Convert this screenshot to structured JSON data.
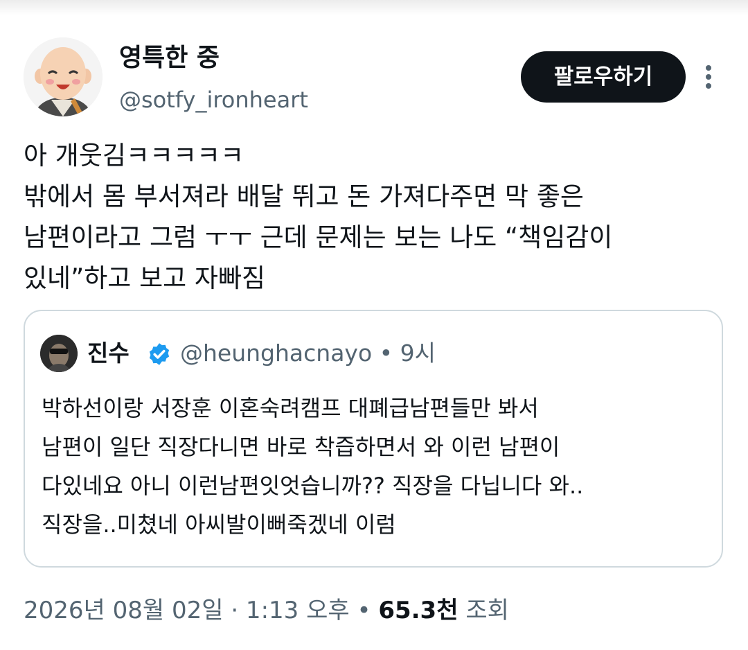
{
  "author": {
    "display_name": "영특한 중",
    "handle": "@sotfy_ironheart"
  },
  "follow_button": {
    "label": "팔로우하기"
  },
  "tweet": {
    "lines": [
      "아 개웃김ㅋㅋㅋㅋㅋ",
      "밖에서 몸 부서져라 배달 뛰고 돈 가져다주면 막 좋은",
      "남편이라고 그럼 ㅜㅜ 근데 문제는 보는 나도 “책임감이",
      "있네”하고 보고 자빠짐"
    ]
  },
  "quoted_tweet": {
    "display_name": "진수",
    "handle_time": "@heunghacnayo • 9시",
    "lines": [
      "박하선이랑 서장훈 이혼숙려캠프 대폐급남편들만 봐서",
      "남편이 일단 직장다니면 바로 착즙하면서 와 이런 남편이",
      "다있네요 아니 이런남편잇엇습니까?? 직장을 다닙니다 와..",
      "직장을..미쳤네 아씨발이뻐죽겠네 이럼"
    ]
  },
  "meta": {
    "timestamp": "2026년 08월 02일 · 1:13 오후 •",
    "views_count": "65.3천",
    "views_label": "조회"
  },
  "colors": {
    "text_primary": "#0f1419",
    "text_secondary": "#536471",
    "border": "#cfd9de",
    "verified_blue": "#1d9bf0"
  },
  "icons": {
    "more": "more-vertical-icon",
    "verified": "verified-badge-icon"
  }
}
